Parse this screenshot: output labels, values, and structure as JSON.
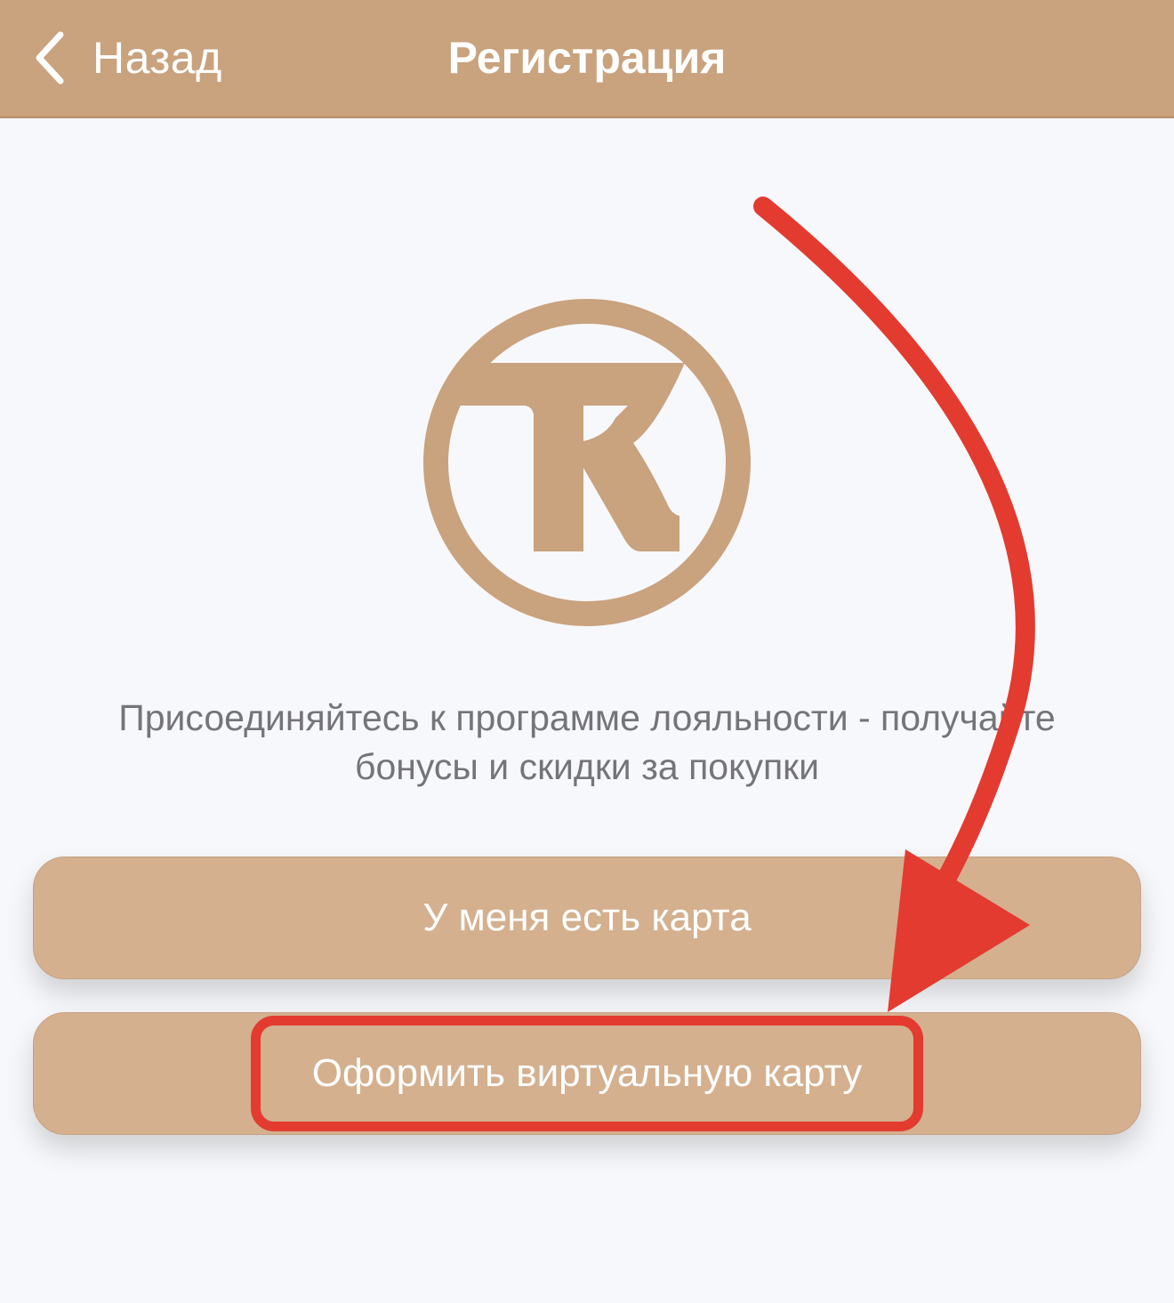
{
  "nav": {
    "back_label": "Назад",
    "title": "Регистрация",
    "bar_color": "#c9a27e"
  },
  "logo": {
    "letter": "K",
    "color": "#c9a27e"
  },
  "tagline": {
    "line1": "Присоединяйтесь к программе лояльности - получайте",
    "line2": "бонусы и скидки за покупки"
  },
  "buttons": {
    "have_card": "У меня есть карта",
    "virtual_card": "Оформить виртуальную карту",
    "color": "#d4b08f"
  },
  "annotation": {
    "color": "#e33b30",
    "icon": "curved-arrow-icon"
  }
}
